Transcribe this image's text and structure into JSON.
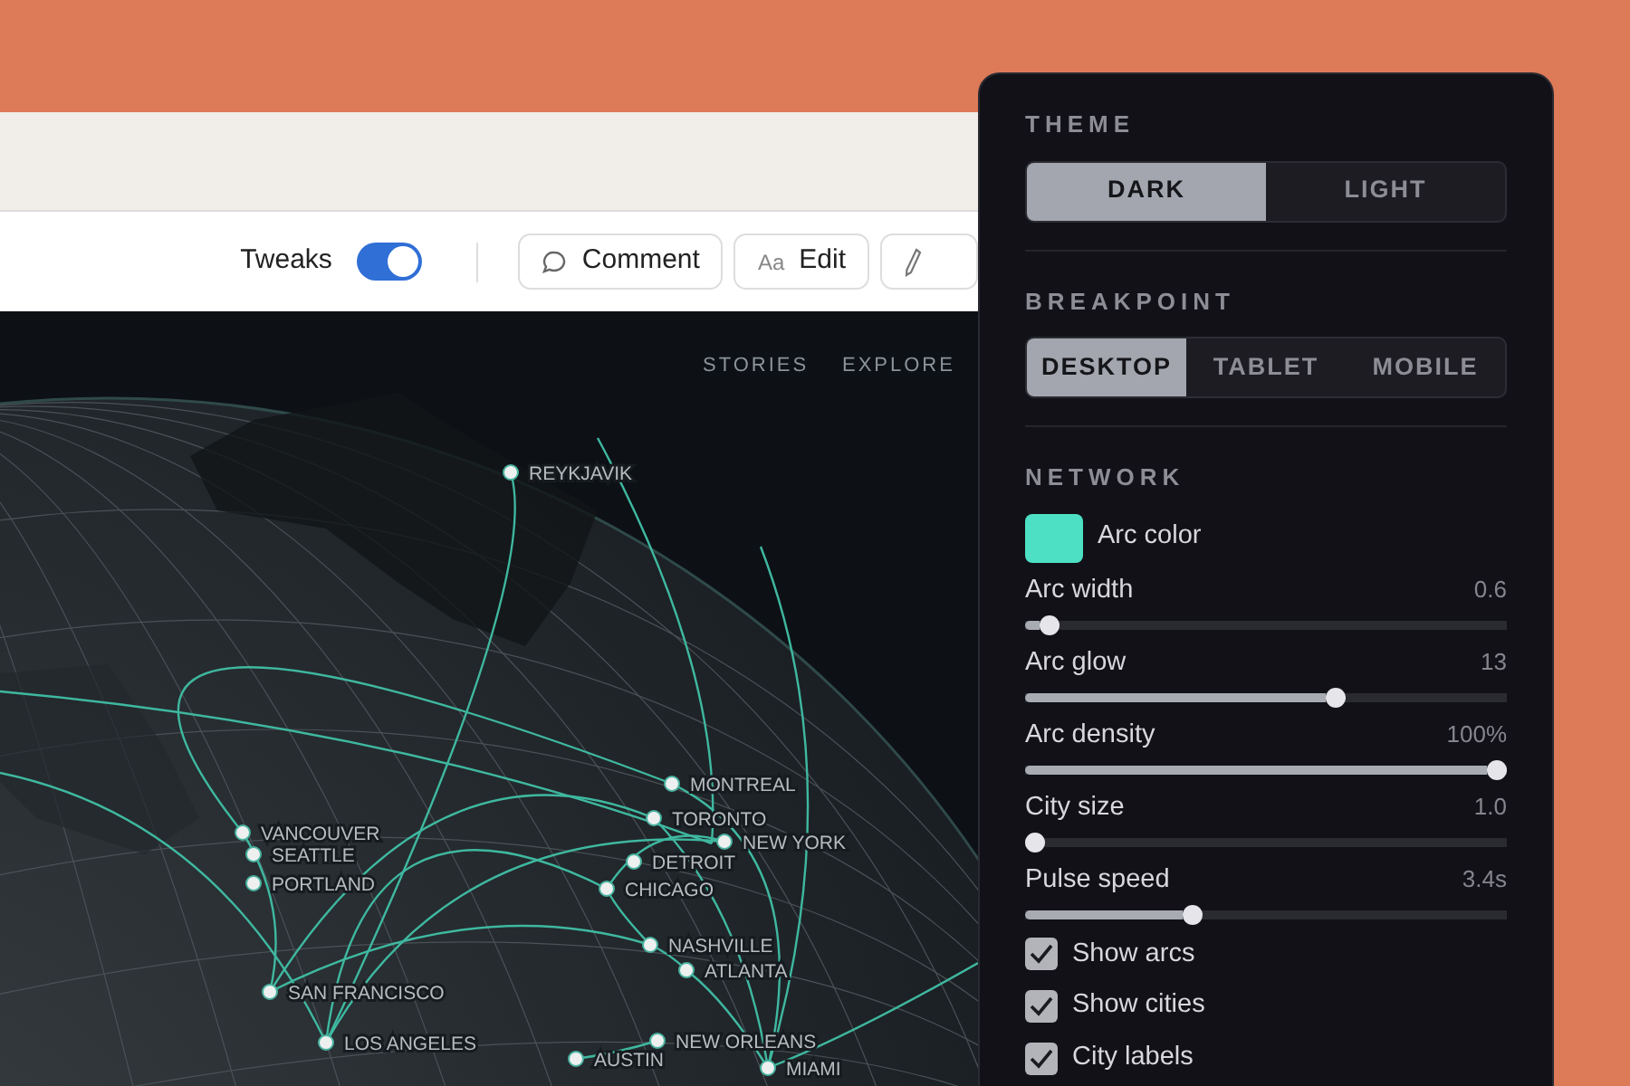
{
  "toolbar": {
    "toggle": {
      "label": "Tweaks",
      "on": true
    },
    "buttons": [
      {
        "kind": "comment",
        "label": "Comment"
      },
      {
        "kind": "edit",
        "icon_text": "Aa",
        "label": "Edit"
      },
      {
        "kind": "pencil"
      }
    ]
  },
  "map": {
    "nav": [
      "STORIES",
      "EXPLORE"
    ],
    "cities": [
      {
        "name": "REYKJAVIK"
      },
      {
        "name": "MONTREAL"
      },
      {
        "name": "TORONTO"
      },
      {
        "name": "DETROIT"
      },
      {
        "name": "NEW YORK"
      },
      {
        "name": "CHICAGO"
      },
      {
        "name": "VANCOUVER"
      },
      {
        "name": "SEATTLE"
      },
      {
        "name": "PORTLAND"
      },
      {
        "name": "SAN FRANCISCO"
      },
      {
        "name": "LOS ANGELES"
      },
      {
        "name": "NASHVILLE"
      },
      {
        "name": "ATLANTA"
      },
      {
        "name": "NEW ORLEANS"
      },
      {
        "name": "AUSTIN"
      },
      {
        "name": "MIAMI"
      }
    ]
  },
  "panel": {
    "sections": [
      {
        "title": "THEME",
        "kind": "segmented",
        "options": [
          {
            "label": "DARK",
            "selected": true
          },
          {
            "label": "LIGHT",
            "selected": false
          }
        ]
      },
      {
        "title": "BREAKPOINT",
        "kind": "segmented",
        "options": [
          {
            "label": "DESKTOP",
            "selected": true
          },
          {
            "label": "TABLET",
            "selected": false
          },
          {
            "label": "MOBILE",
            "selected": false
          }
        ]
      },
      {
        "title": "NETWORK",
        "kind": "controls",
        "items": [
          {
            "kind": "color",
            "label": "Arc color",
            "color": "#4de0c4"
          },
          {
            "kind": "slider",
            "label": "Arc width",
            "reading": "0.6",
            "level": 0.03
          },
          {
            "kind": "slider",
            "label": "Arc glow",
            "reading": "13",
            "level": 0.65
          },
          {
            "kind": "slider",
            "label": "Arc density",
            "reading": "100%",
            "level": 1.0
          },
          {
            "kind": "slider",
            "label": "City size",
            "reading": "1.0",
            "level": 0.0
          },
          {
            "kind": "slider",
            "label": "Pulse speed",
            "reading": "3.4s",
            "level": 0.34
          },
          {
            "kind": "checkbox",
            "label": "Show arcs",
            "checked": true
          },
          {
            "kind": "checkbox",
            "label": "Show cities",
            "checked": true
          },
          {
            "kind": "checkbox",
            "label": "City labels",
            "checked": true
          }
        ]
      }
    ]
  }
}
